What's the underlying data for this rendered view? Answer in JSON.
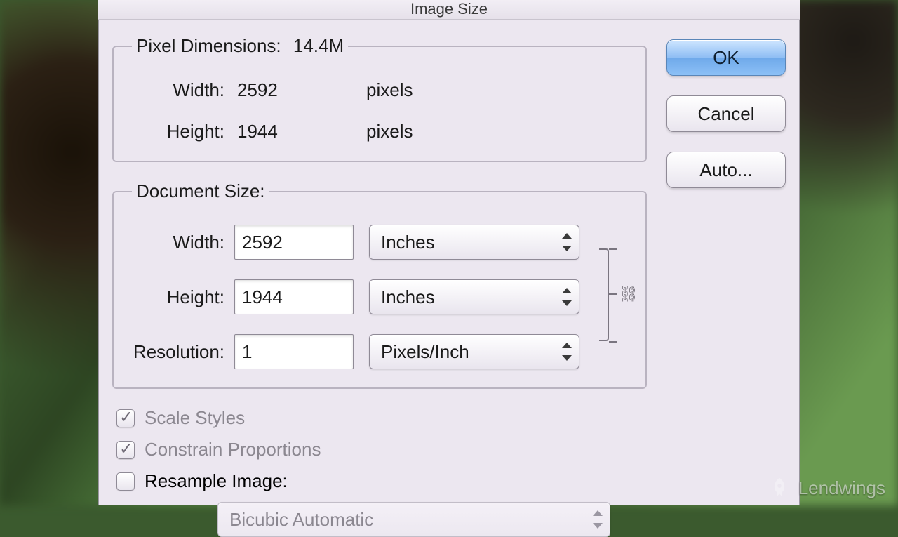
{
  "dialog": {
    "title": "Image Size",
    "buttons": {
      "ok": "OK",
      "cancel": "Cancel",
      "auto": "Auto..."
    }
  },
  "pixel_dimensions": {
    "legend": "Pixel Dimensions:",
    "size": "14.4M",
    "width_label": "Width:",
    "width_value": "2592",
    "width_unit": "pixels",
    "height_label": "Height:",
    "height_value": "1944",
    "height_unit": "pixels"
  },
  "document_size": {
    "legend": "Document Size:",
    "width_label": "Width:",
    "width_value": "2592",
    "width_unit": "Inches",
    "height_label": "Height:",
    "height_value": "1944",
    "height_unit": "Inches",
    "resolution_label": "Resolution:",
    "resolution_value": "1",
    "resolution_unit": "Pixels/Inch"
  },
  "options": {
    "scale_styles": {
      "label": "Scale Styles",
      "checked": true
    },
    "constrain": {
      "label": "Constrain Proportions",
      "checked": true
    },
    "resample": {
      "label": "Resample Image:",
      "checked": false,
      "method": "Bicubic Automatic"
    }
  },
  "watermark": "Lendwings"
}
